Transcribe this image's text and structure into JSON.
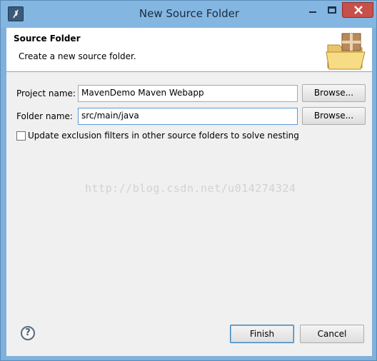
{
  "window": {
    "title": "New Source Folder",
    "colors": {
      "frame": "#84b6e2",
      "close_button": "#c7504a"
    }
  },
  "banner": {
    "title": "Source Folder",
    "description": "Create a new source folder."
  },
  "form": {
    "project_label": "Project name:",
    "project_value": "MavenDemo Maven Webapp",
    "project_browse": "Browse...",
    "folder_label": "Folder name:",
    "folder_value": "src/main/java",
    "folder_browse": "Browse...",
    "exclusion_checkbox_label": "Update exclusion filters in other source folders to solve nesting",
    "exclusion_checked": false
  },
  "watermark": "http://blog.csdn.net/u014274324",
  "footer": {
    "help_symbol": "?",
    "finish": "Finish",
    "cancel": "Cancel"
  }
}
